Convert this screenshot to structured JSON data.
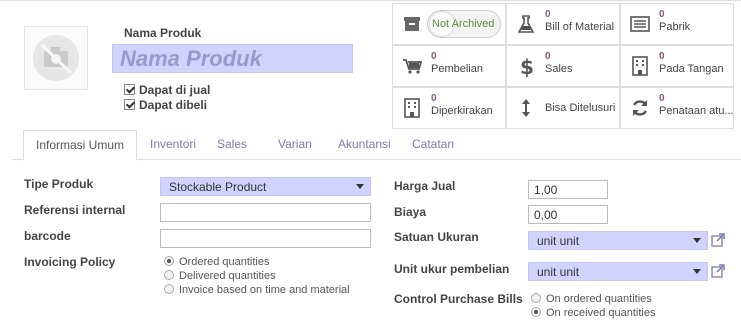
{
  "product": {
    "name_label": "Nama Produk",
    "name_placeholder": "Nama Produk",
    "checks": [
      {
        "label": "Dapat di jual",
        "checked": true
      },
      {
        "label": "Dapat dibeli",
        "checked": true
      }
    ]
  },
  "smart_buttons": {
    "archive": {
      "label": "Not Archived",
      "icon": "archive-icon"
    },
    "bom": {
      "count": "0",
      "label": "Bill of Material",
      "icon": "flask-icon"
    },
    "factory": {
      "count": "0",
      "label": "Pabrik",
      "icon": "list-icon"
    },
    "purchase": {
      "count": "0",
      "label": "Pembelian",
      "icon": "cart-icon"
    },
    "sales": {
      "count": "0",
      "label": "Sales",
      "icon": "dollar-icon"
    },
    "on_hand": {
      "count": "0",
      "label": "Pada Tangan",
      "icon": "building-icon"
    },
    "forecast": {
      "count": "0",
      "label": "Diperkirakan",
      "icon": "building-icon"
    },
    "trace": {
      "label": "Bisa Ditelusuri",
      "icon": "updown-arrow-icon"
    },
    "reorder": {
      "count": "0",
      "label": "Penataan atu...",
      "icon": "refresh-icon"
    }
  },
  "tabs": [
    {
      "label": "Informasi Umum",
      "active": true
    },
    {
      "label": "Inventori",
      "active": false
    },
    {
      "label": "Sales",
      "active": false
    },
    {
      "label": "Varian",
      "active": false
    },
    {
      "label": "Akuntansi",
      "active": false
    },
    {
      "label": "Catatan",
      "active": false
    }
  ],
  "left_form": {
    "product_type": {
      "label": "Tipe Produk",
      "value": "Stockable Product"
    },
    "internal_ref": {
      "label": "Referensi internal",
      "value": ""
    },
    "barcode": {
      "label": "barcode",
      "value": ""
    },
    "invoicing": {
      "label": "Invoicing Policy",
      "options": [
        {
          "label": "Ordered quantities",
          "selected": true
        },
        {
          "label": "Delivered quantities",
          "selected": false
        },
        {
          "label": "Invoice based on time and material",
          "selected": false
        }
      ]
    }
  },
  "right_form": {
    "sale_price": {
      "label": "Harga Jual",
      "value": "1,00"
    },
    "cost": {
      "label": "Biaya",
      "value": "0,00"
    },
    "uom": {
      "label": "Satuan Ukuran",
      "value": "unit unit"
    },
    "purchase_uom": {
      "label": "Unit ukur pembelian",
      "value": "unit unit"
    },
    "control_bills": {
      "label": "Control Purchase Bills",
      "options": [
        {
          "label": "On ordered quantities",
          "selected": false
        },
        {
          "label": "On received quantities",
          "selected": true
        }
      ]
    }
  },
  "colors": {
    "required_field": "#d2d2ff",
    "link": "#7c7bad",
    "counter": "#875a7b"
  }
}
